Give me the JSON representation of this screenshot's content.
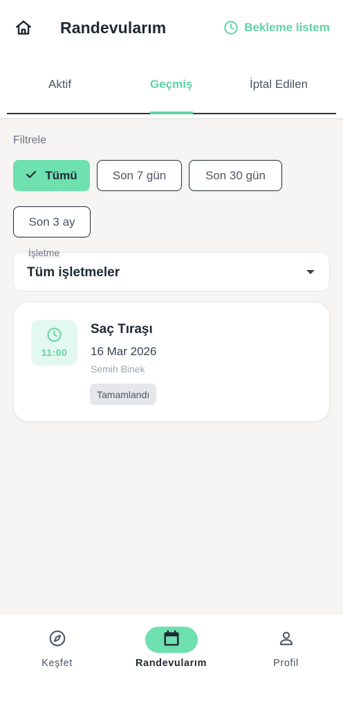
{
  "header": {
    "title": "Randevularım",
    "home_icon": "home-icon",
    "waitlist_label": "Bekleme listem",
    "waitlist_icon": "clock-icon",
    "accent_color": "#5fd3a3"
  },
  "tabs": [
    {
      "label": "Aktif",
      "active": false
    },
    {
      "label": "Geçmiş",
      "active": true
    },
    {
      "label": "İptal Edilen",
      "active": false
    }
  ],
  "filter": {
    "label": "Filtrele",
    "chips": [
      {
        "label": "Tümü",
        "selected": true,
        "icon": "check-icon"
      },
      {
        "label": "Son 7 gün",
        "selected": false
      },
      {
        "label": "Son 30 gün",
        "selected": false
      },
      {
        "label": "Son 3 ay",
        "selected": false
      }
    ]
  },
  "business_select": {
    "label": "İşletme",
    "value": "Tüm işletmeler",
    "icon": "dropdown-arrow-icon"
  },
  "appointments": [
    {
      "time": "11:00",
      "service": "Saç Tıraşı",
      "date": "16 Mar 2026",
      "staff": "Semih Binek",
      "status": "Tamamlandı"
    }
  ],
  "bottom_nav": [
    {
      "label": "Keşfet",
      "icon": "compass-icon",
      "active": false
    },
    {
      "label": "Randevularım",
      "icon": "calendar-icon",
      "active": true
    },
    {
      "label": "Profil",
      "icon": "person-icon",
      "active": false
    }
  ]
}
